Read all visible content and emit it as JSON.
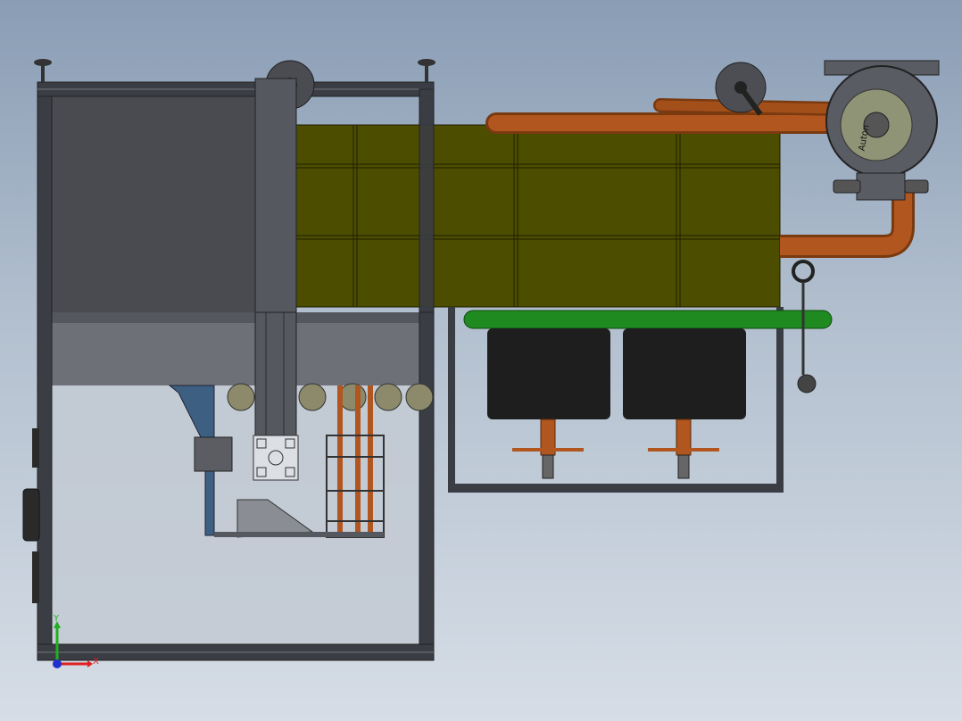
{
  "viewport": {
    "background_top": "#8a9db5",
    "background_bottom": "#d6dde6"
  },
  "model": {
    "frame_color": "#3a3d44",
    "panel_dark": "#4a4b50",
    "tank_color": "#4d4d00",
    "pipe_color": "#b0561e",
    "green_pipe_color": "#1f8a1f",
    "filter_color": "#1e1e1e",
    "pump_color": "#5a5c63",
    "glass_color": "#c6ccd6",
    "pump_label": "Auton"
  },
  "triad": {
    "x_label": "X",
    "y_label": "Y",
    "x_color": "#e02020",
    "y_color": "#20b020",
    "z_color": "#2030d0"
  }
}
